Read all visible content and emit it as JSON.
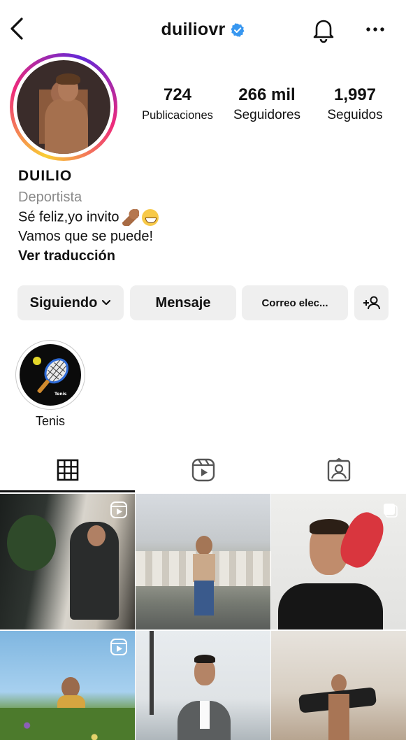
{
  "header": {
    "username": "duiliovr",
    "back_icon": "chevron-left-icon",
    "verified_icon": "verified-badge-icon",
    "notifications_icon": "bell-icon",
    "more_icon": "more-horizontal-icon"
  },
  "profile": {
    "avatar_ring_colors": [
      "#f9ce34",
      "#ee2a7b",
      "#6228d7"
    ],
    "stats": [
      {
        "value": "724",
        "label": "Publicaciones"
      },
      {
        "value": "266 mil",
        "label": "Seguidores"
      },
      {
        "value": "1,997",
        "label": "Seguidos"
      }
    ],
    "display_name": "DUILIO",
    "category": "Deportista",
    "bio_line_1": "Sé feliz,yo invito",
    "bio_line_2": "Vamos que se puede!",
    "translate_label": "Ver traducción"
  },
  "actions": {
    "following_label": "Siguiendo",
    "message_label": "Mensaje",
    "email_label": "Correo elec...",
    "add_person_icon": "add-person-icon"
  },
  "highlights": [
    {
      "label": "Tenis",
      "icon": "tennis-racket-icon",
      "caption": "Tenis"
    }
  ],
  "tabs": [
    {
      "icon": "grid-icon",
      "active": true
    },
    {
      "icon": "reels-icon",
      "active": false
    },
    {
      "icon": "tagged-icon",
      "active": false
    }
  ],
  "posts": [
    {
      "overlay": "reel-icon"
    },
    {
      "overlay": ""
    },
    {
      "overlay": "multiple-icon"
    },
    {
      "overlay": "reel-icon"
    },
    {
      "overlay": ""
    },
    {
      "overlay": ""
    }
  ]
}
